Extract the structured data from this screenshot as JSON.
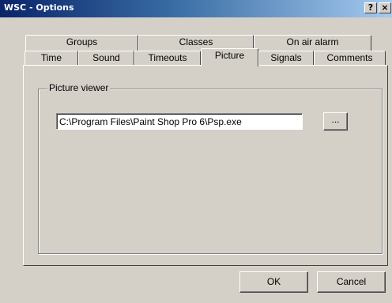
{
  "window": {
    "title": "WSC - Options",
    "help_label": "?",
    "close_label": "×"
  },
  "tabs": {
    "row_top": [
      "Groups",
      "Classes",
      "On air alarm"
    ],
    "row_bottom": [
      "Time",
      "Sound",
      "Timeouts",
      "Picture",
      "Signals",
      "Comments"
    ],
    "active": "Picture"
  },
  "picture_viewer": {
    "group_label": "Picture viewer",
    "path_value": "C:\\Program Files\\Paint Shop Pro 6\\Psp.exe",
    "browse_label": "..."
  },
  "buttons": {
    "ok": "OK",
    "cancel": "Cancel"
  }
}
